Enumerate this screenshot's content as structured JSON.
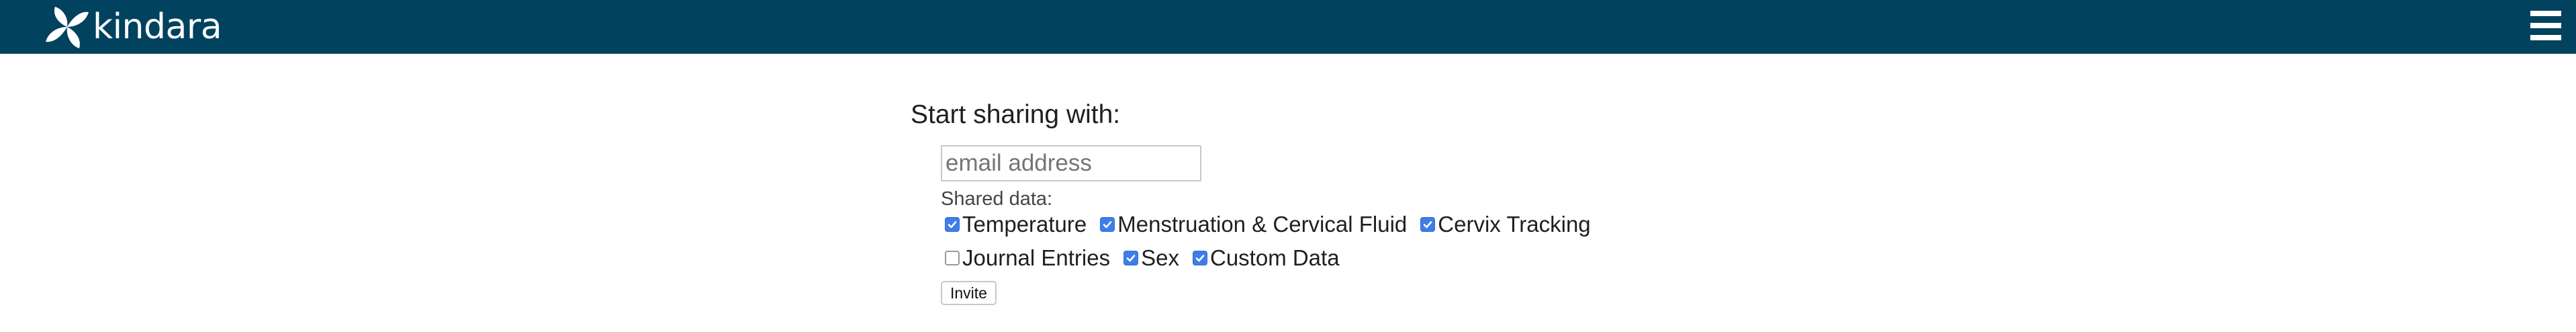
{
  "header": {
    "logo_text": "kindara",
    "logo_icon": "kindara-leaf-logo-icon",
    "menu_icon": "hamburger-menu-icon",
    "background_color": "#01425e"
  },
  "share": {
    "heading": "Start sharing with:",
    "email_placeholder": "email address",
    "email_value": "",
    "shared_data_label": "Shared data:",
    "options_row1": [
      {
        "label": "Temperature",
        "checked": true
      },
      {
        "label": "Menstruation & Cervical Fluid",
        "checked": true
      },
      {
        "label": "Cervix Tracking",
        "checked": true
      }
    ],
    "options_row2": [
      {
        "label": "Journal Entries",
        "checked": false
      },
      {
        "label": "Sex",
        "checked": true
      },
      {
        "label": "Custom Data",
        "checked": true
      }
    ],
    "invite_label": "Invite",
    "checkbox_color": "#3f7ee8"
  }
}
